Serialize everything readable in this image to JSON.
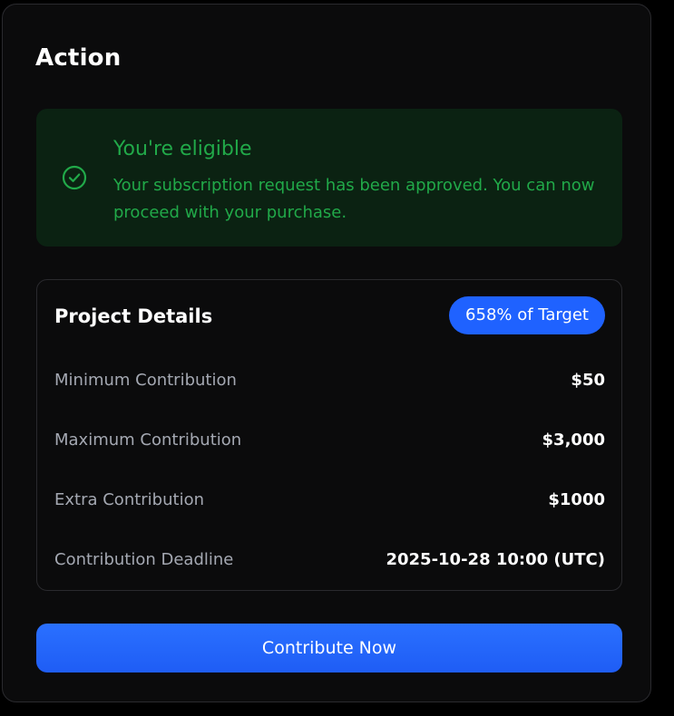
{
  "panel": {
    "title": "Action"
  },
  "eligibility": {
    "icon": "check-circle-icon",
    "heading": "You're eligible",
    "message": "Your subscription request has been approved. You can now proceed with your purchase.",
    "color": "#21a949",
    "background": "#0b2212"
  },
  "project_details": {
    "title": "Project Details",
    "target_badge": "658% of Target",
    "rows": [
      {
        "label": "Minimum Contribution",
        "value": "$50"
      },
      {
        "label": "Maximum Contribution",
        "value": "$3,000"
      },
      {
        "label": "Extra Contribution",
        "value": "$1000"
      },
      {
        "label": "Contribution Deadline",
        "value": "2025-10-28 10:00 (UTC)"
      }
    ]
  },
  "actions": {
    "contribute_label": "Contribute Now",
    "accent": "#1f62ff"
  }
}
